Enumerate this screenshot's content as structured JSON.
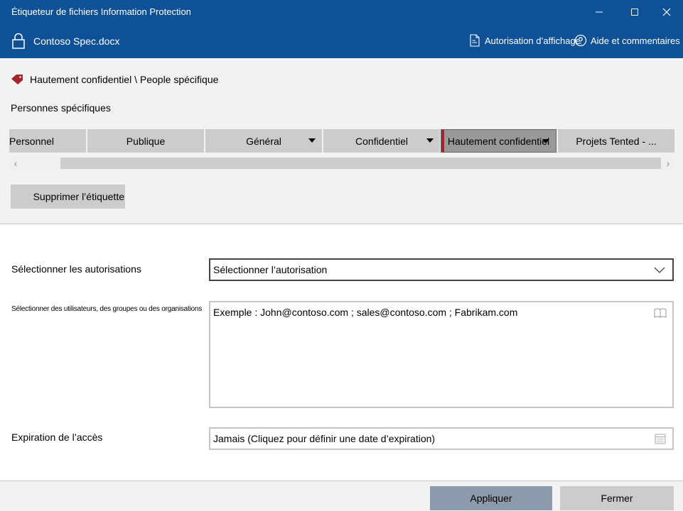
{
  "window": {
    "title": "Étiqueteur de fichiers Information Protection",
    "controls": [
      "minimize",
      "maximize",
      "close"
    ]
  },
  "file": {
    "name": "Contoso Spec.docx",
    "view_permission": "Autorisation d’affichage",
    "help": "Aide et commentaires"
  },
  "current_label": {
    "text": "Hautement confidentiel \\ People spécifique",
    "color": "#a4262c"
  },
  "sublabel_heading": "Personnes spécifiques",
  "labels": [
    {
      "text": "Personnel",
      "has_dropdown": false,
      "selected": false
    },
    {
      "text": "Publique",
      "has_dropdown": false,
      "selected": false
    },
    {
      "text": "Général",
      "has_dropdown": true,
      "selected": false
    },
    {
      "text": "Confidentiel",
      "has_dropdown": true,
      "selected": false
    },
    {
      "text": "Hautement confidentiel",
      "has_dropdown": true,
      "selected": true
    },
    {
      "text": "Projets Tented - ...",
      "has_dropdown": false,
      "selected": false
    }
  ],
  "remove_label": "Supprimer l’étiquette",
  "form": {
    "permissions_label": "Sélectionner les autorisations",
    "permissions_value": "Sélectionner l’autorisation",
    "users_label": "Sélectionner des utilisateurs, des groupes ou des organisations",
    "users_placeholder": "Exemple : John@contoso.com ; sales@contoso.com ; Fabrikam.com",
    "expiry_label": "Expiration de l’accès",
    "expiry_value": "Jamais (Cliquez pour définir une date d’expiration)"
  },
  "footer": {
    "apply": "Appliquer",
    "close": "Fermer"
  },
  "colors": {
    "titlebar": "#0f5196",
    "label_tag": "#a4262c",
    "apply_button": "#8c9aac"
  }
}
